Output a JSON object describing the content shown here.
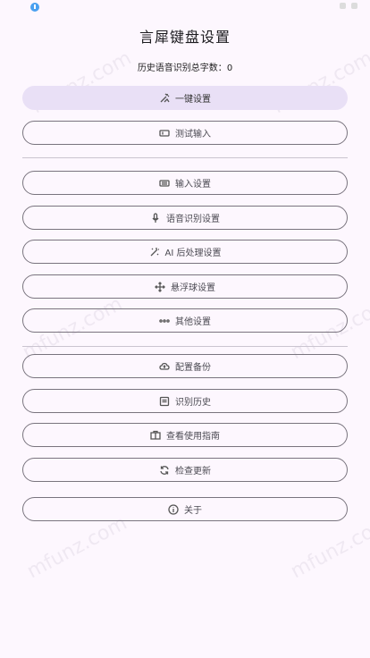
{
  "title": "言犀键盘设置",
  "stats": {
    "label": "历史语音识别总字数：",
    "value": "0"
  },
  "buttons": {
    "one_click": "一键设置",
    "test_input": "测试输入",
    "input_settings": "输入设置",
    "voice_settings": "语音识别设置",
    "ai_settings": "AI 后处理设置",
    "float_ball": "悬浮球设置",
    "other_settings": "其他设置",
    "backup": "配置备份",
    "history": "识别历史",
    "guide": "查看使用指南",
    "update": "检查更新",
    "about": "关于"
  },
  "watermark": "mfunz.com",
  "colors": {
    "background": "#fdf7fe",
    "filled_button": "#e9e0f6",
    "outline": "#79747e"
  }
}
